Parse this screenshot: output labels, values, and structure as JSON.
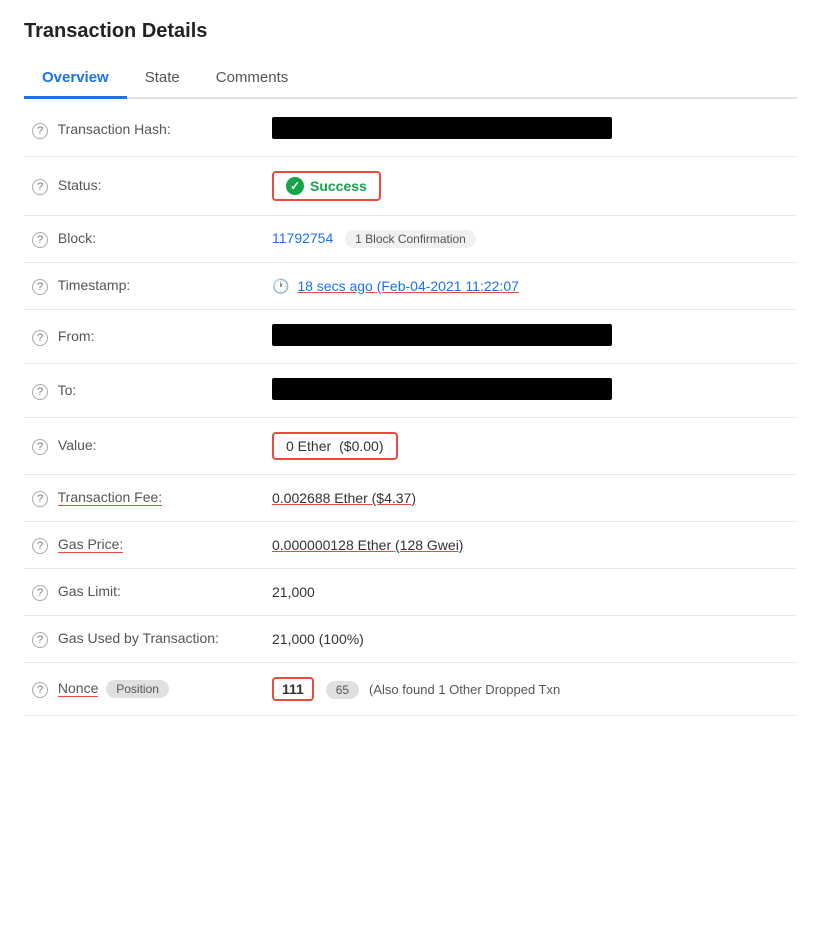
{
  "page": {
    "title": "Transaction Details"
  },
  "tabs": [
    {
      "id": "overview",
      "label": "Overview",
      "active": true
    },
    {
      "id": "state",
      "label": "State",
      "active": false
    },
    {
      "id": "comments",
      "label": "Comments",
      "active": false
    }
  ],
  "fields": {
    "transaction_hash": {
      "label": "Transaction Hash:",
      "value": ""
    },
    "status": {
      "label": "Status:",
      "value": "Success"
    },
    "block": {
      "label": "Block:",
      "block_number": "11792754",
      "confirmations": "1 Block Confirmation"
    },
    "timestamp": {
      "label": "Timestamp:",
      "value": "18 secs ago (Feb-04-2021 11:22:07"
    },
    "from": {
      "label": "From:",
      "value": ""
    },
    "to": {
      "label": "To:",
      "value": ""
    },
    "value": {
      "label": "Value:",
      "ether": "0 Ether",
      "usd": "($0.00)"
    },
    "transaction_fee": {
      "label": "Transaction Fee:",
      "value": "0.002688 Ether ($4.37)"
    },
    "gas_price": {
      "label": "Gas Price:",
      "value": "0.000000128 Ether (128 Gwei)"
    },
    "gas_limit": {
      "label": "Gas Limit:",
      "value": "21,000"
    },
    "gas_used": {
      "label": "Gas Used by Transaction:",
      "value": "21,000 (100%)"
    },
    "nonce": {
      "label": "Nonce",
      "position_label": "Position",
      "nonce_value": "111",
      "position_value": "65",
      "also_found": "(Also found 1 Other Dropped Txn"
    }
  }
}
